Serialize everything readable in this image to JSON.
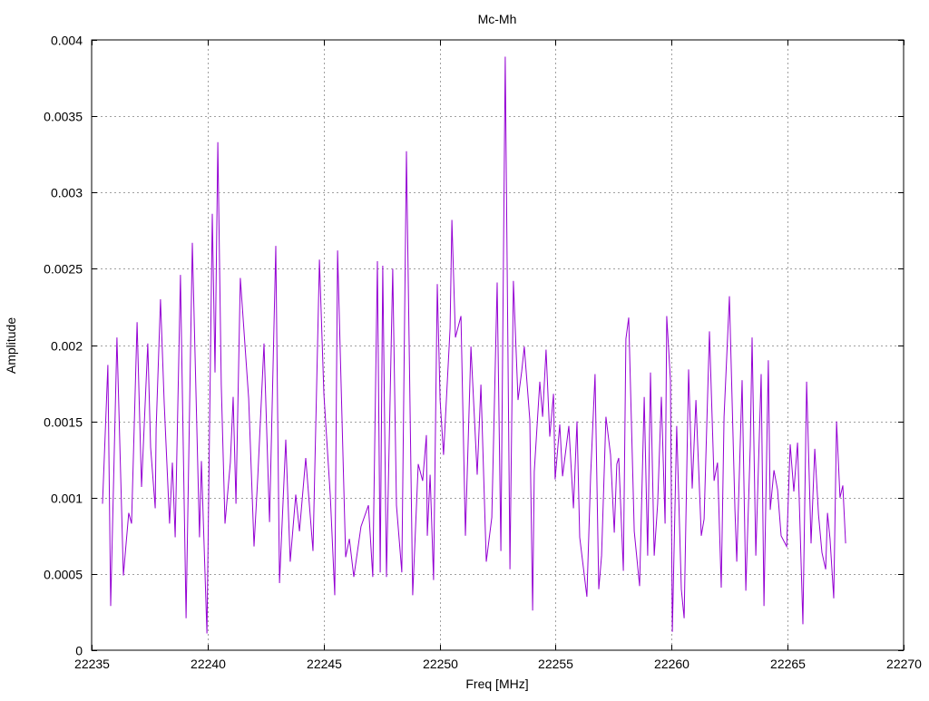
{
  "chart_data": {
    "type": "line",
    "title": "Mc-Mh",
    "xlabel": "Freq [MHz]",
    "ylabel": "Amplitude",
    "xlim": [
      22235,
      22270
    ],
    "ylim": [
      0,
      0.004
    ],
    "xticks": [
      22235,
      22240,
      22245,
      22250,
      22255,
      22260,
      22265,
      22270
    ],
    "yticks": [
      "0",
      "0.0005",
      "0.001",
      "0.0015",
      "0.002",
      "0.0025",
      "0.003",
      "0.0035",
      "0.004"
    ],
    "grid": true,
    "legend": "none",
    "series": [
      {
        "name": "Mc-Mh",
        "color": "#9400d3",
        "x": [
          22235.47,
          22235.7,
          22235.82,
          22236.09,
          22236.37,
          22236.6,
          22236.72,
          22236.96,
          22237.15,
          22237.42,
          22237.54,
          22237.74,
          22237.78,
          22237.97,
          22238.13,
          22238.36,
          22238.48,
          22238.6,
          22238.83,
          22239.07,
          22239.34,
          22239.65,
          22239.73,
          22239.97,
          22240.2,
          22240.32,
          22240.44,
          22240.59,
          22240.75,
          22240.98,
          22241.1,
          22241.22,
          22241.41,
          22241.77,
          22242.0,
          22242.16,
          22242.43,
          22242.67,
          22242.94,
          22243.1,
          22243.37,
          22243.56,
          22243.8,
          22243.96,
          22244.23,
          22244.54,
          22244.82,
          22245.01,
          22245.29,
          22245.48,
          22245.6,
          22245.95,
          22246.11,
          22246.3,
          22246.61,
          22246.93,
          22247.12,
          22247.32,
          22247.44,
          22247.55,
          22247.71,
          22247.98,
          22248.14,
          22248.37,
          22248.57,
          22248.84,
          22249.08,
          22249.27,
          22249.43,
          22249.47,
          22249.59,
          22249.74,
          22249.9,
          22250.02,
          22250.17,
          22250.45,
          22250.53,
          22250.68,
          22250.92,
          22251.11,
          22251.35,
          22251.62,
          22251.78,
          22252.01,
          22252.25,
          22252.48,
          22252.64,
          22252.83,
          22253.03,
          22253.18,
          22253.38,
          22253.54,
          22253.65,
          22253.89,
          22254.01,
          22254.08,
          22254.32,
          22254.44,
          22254.59,
          22254.75,
          22254.91,
          22254.98,
          22255.18,
          22255.3,
          22255.57,
          22255.77,
          22255.92,
          22256.04,
          22256.35,
          22256.51,
          22256.7,
          22256.86,
          22256.98,
          22257.17,
          22257.37,
          22257.53,
          22257.64,
          22257.72,
          22257.92,
          22258.03,
          22258.15,
          22258.39,
          22258.62,
          22258.82,
          22258.97,
          22259.09,
          22259.25,
          22259.4,
          22259.56,
          22259.72,
          22259.79,
          22259.95,
          22260.03,
          22260.22,
          22260.42,
          22260.54,
          22260.73,
          22260.89,
          22261.05,
          22261.28,
          22261.4,
          22261.63,
          22261.83,
          22261.98,
          22262.14,
          22262.26,
          22262.49,
          22262.73,
          22262.81,
          22263.04,
          22263.2,
          22263.39,
          22263.47,
          22263.63,
          22263.86,
          22263.98,
          22264.17,
          22264.25,
          22264.41,
          22264.57,
          22264.72,
          22264.96,
          22265.11,
          22265.27,
          22265.43,
          22265.54,
          22265.66,
          22265.82,
          22266.01,
          22266.17,
          22266.33,
          22266.48,
          22266.64,
          22266.72,
          22266.83,
          22266.99,
          22267.11,
          22267.26,
          22267.38,
          22267.5
        ],
        "y": [
          0.00096,
          0.00187,
          0.00029,
          0.00205,
          0.00049,
          0.0009,
          0.00083,
          0.00215,
          0.00107,
          0.00201,
          0.00133,
          0.00093,
          0.00145,
          0.0023,
          0.00162,
          0.00083,
          0.00123,
          0.00074,
          0.00246,
          0.00021,
          0.00267,
          0.00074,
          0.00124,
          0.00011,
          0.00286,
          0.00182,
          0.00333,
          0.00174,
          0.00083,
          0.00123,
          0.00166,
          0.00096,
          0.00244,
          0.00165,
          0.00068,
          0.00113,
          0.00201,
          0.00084,
          0.00265,
          0.00044,
          0.00138,
          0.00058,
          0.00102,
          0.00078,
          0.00126,
          0.00065,
          0.00256,
          0.00168,
          0.00101,
          0.00036,
          0.00262,
          0.00061,
          0.00073,
          0.00048,
          0.00081,
          0.00095,
          0.00048,
          0.00255,
          0.00051,
          0.00252,
          0.00048,
          0.0025,
          0.00095,
          0.00051,
          0.00327,
          0.00036,
          0.00122,
          0.00111,
          0.00141,
          0.00075,
          0.00115,
          0.00046,
          0.0024,
          0.00164,
          0.00128,
          0.00211,
          0.00282,
          0.00205,
          0.00219,
          0.00075,
          0.00199,
          0.00115,
          0.00174,
          0.00058,
          0.00087,
          0.00241,
          0.00065,
          0.00389,
          0.00053,
          0.00242,
          0.00164,
          0.00183,
          0.00199,
          0.00151,
          0.00026,
          0.00117,
          0.00176,
          0.00153,
          0.00197,
          0.0014,
          0.00168,
          0.00112,
          0.00148,
          0.00114,
          0.00147,
          0.00093,
          0.0015,
          0.00074,
          0.00035,
          0.00114,
          0.00181,
          0.0004,
          0.00062,
          0.00153,
          0.00128,
          0.00077,
          0.00122,
          0.00126,
          0.00052,
          0.00204,
          0.00218,
          0.00078,
          0.00042,
          0.00166,
          0.00062,
          0.00182,
          0.00062,
          0.00096,
          0.00166,
          0.00083,
          0.00219,
          0.00177,
          0.00012,
          0.00147,
          0.0004,
          0.00021,
          0.00184,
          0.00106,
          0.00164,
          0.00075,
          0.00086,
          0.00209,
          0.00111,
          0.00123,
          0.00041,
          0.00153,
          0.00232,
          0.00092,
          0.00058,
          0.00177,
          0.00039,
          0.00134,
          0.00205,
          0.00062,
          0.00181,
          0.00029,
          0.0019,
          0.00092,
          0.00118,
          0.00105,
          0.00075,
          0.00068,
          0.00135,
          0.00104,
          0.00136,
          0.00078,
          0.00017,
          0.00176,
          0.0007,
          0.00132,
          0.00089,
          0.00064,
          0.00053,
          0.0009,
          0.00073,
          0.00034,
          0.0015,
          0.001,
          0.00108,
          0.0007
        ]
      }
    ]
  }
}
